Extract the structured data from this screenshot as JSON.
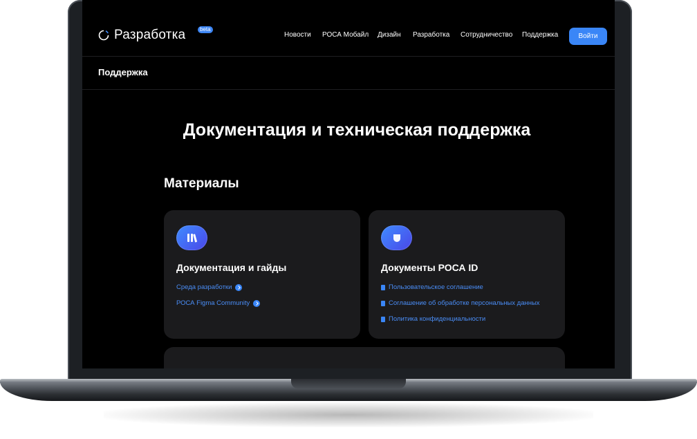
{
  "header": {
    "logo_text": "Разработка",
    "beta_badge": "beta",
    "menu": [
      "Новости",
      "РОСА Мобайл",
      "Дизайн",
      "Разработка",
      "Сотрудничество",
      "Поддержка"
    ],
    "login_label": "Войти"
  },
  "subnav": {
    "title": "Поддержка"
  },
  "main": {
    "heading": "Документация и техническая поддержка",
    "section_title": "Материалы",
    "cards": [
      {
        "title": "Документация и гайды",
        "icon": "books-icon",
        "links": [
          "Среда разработки",
          "РОСА Figma Community"
        ]
      },
      {
        "title": "Документы РОСА ID",
        "icon": "shield-icon",
        "links": [
          "Пользовательское соглашение",
          "Соглашение об обработке персональных данных",
          "Политика конфиденциальности"
        ]
      }
    ]
  },
  "colors": {
    "accent": "#3a86f7",
    "background": "#000000",
    "card": "#1b1b1d",
    "link": "#4a8df6"
  }
}
